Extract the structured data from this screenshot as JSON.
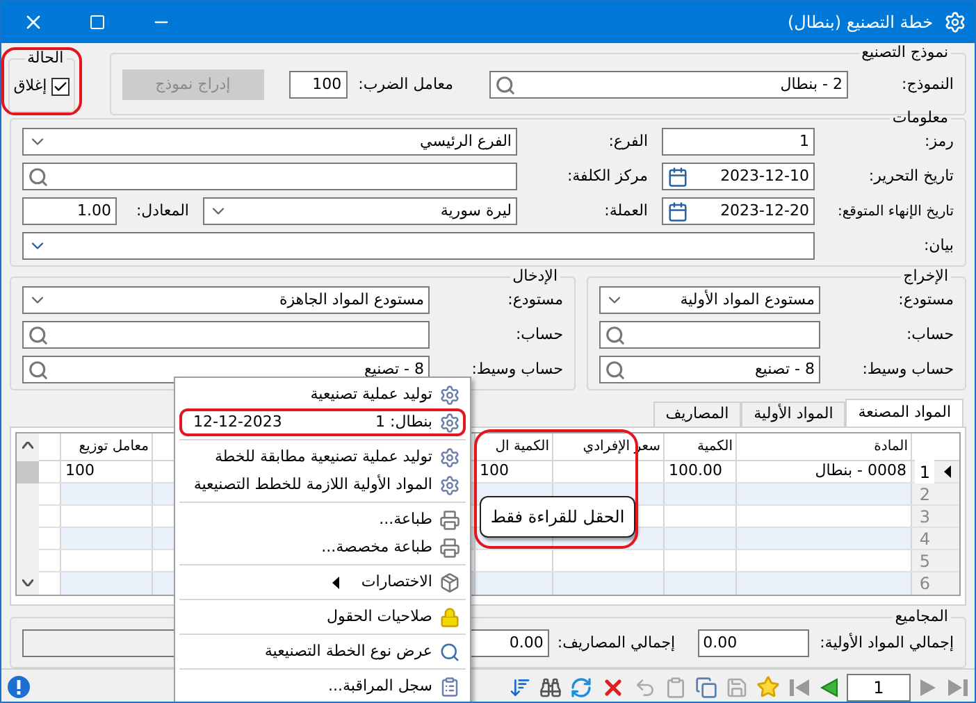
{
  "window": {
    "title": "خطة التصنيع (بنطال)"
  },
  "model_group": {
    "title": "نموذج التصنيع",
    "model_label": "النموذج:",
    "model_value": "2 - بنطال",
    "multiplier_label": "معامل الضرب:",
    "multiplier_value": "100",
    "insert_button": {
      "label": "إدراج نموذج",
      "disabled": true
    }
  },
  "status_group": {
    "title": "الحالة",
    "highlighted": true,
    "closed": {
      "label": "إغلاق",
      "checked": true
    }
  },
  "info": {
    "title": "معلومات",
    "code_label": "رمز:",
    "code": "1",
    "branch_label": "الفرع:",
    "branch": "الفرع الرئيسي",
    "date_label": "تاريخ التحرير:",
    "date": "2023-12-10",
    "cost_center_label": "مركز الكلفة:",
    "end_date_label": "تاريخ الإنهاء المتوقع:",
    "end_date": "2023-12-20",
    "currency_label": "العملة:",
    "currency": "ليرة سورية",
    "rate_label": "المعادل:",
    "rate": "1.00",
    "statement_label": "بيان:"
  },
  "output": {
    "title": "الإخراج",
    "rows": [
      {
        "kind": "select",
        "label": "مستودع:",
        "value": "مستودع المواد الأولية"
      },
      {
        "kind": "search",
        "label": "حساب:"
      },
      {
        "kind": "search",
        "label": "حساب وسيط:",
        "value": "8 - تصنيع"
      }
    ]
  },
  "input": {
    "title": "الإدخال",
    "rows": [
      {
        "kind": "select",
        "label": "مستودع:",
        "value": "مستودع المواد الجاهزة"
      },
      {
        "kind": "search",
        "label": "حساب:"
      },
      {
        "kind": "search",
        "label": "حساب وسيط:",
        "value": "8 - تصنيع"
      }
    ]
  },
  "tabs": [
    {
      "label": "المواد المصنعة",
      "selected": true
    },
    {
      "label": "المواد الأولية",
      "selected": false
    },
    {
      "label": "المصاريف",
      "selected": false
    }
  ],
  "grid": {
    "columns": [
      "المادة",
      "الكمية",
      "سعر الإفرادي",
      "الكمية ال",
      "معامل توزيع"
    ],
    "rows": [
      {
        "number": "1",
        "selected": true,
        "cells": [
          "0008 - بنطال",
          "100.00",
          null,
          "100",
          "100"
        ]
      },
      {
        "number": "2",
        "selected": false
      },
      {
        "number": "3",
        "selected": false
      },
      {
        "number": "4",
        "selected": false
      },
      {
        "number": "5",
        "selected": false
      },
      {
        "number": "6",
        "selected": false
      }
    ]
  },
  "totals": {
    "title": "المجاميع",
    "raw_label": "إجمالي المواد الأولية:",
    "raw": "0.00",
    "expenses_label": "إجمالي المصاريف:",
    "expenses": "0.00"
  },
  "context_menu": {
    "groups": [
      [
        {
          "kind": "gear",
          "label": "توليد عملية تصنيعية",
          "highlighted": false
        },
        {
          "kind": "gear",
          "label": "بنطال: 1",
          "detail": "12-12-2023",
          "highlighted": true
        }
      ],
      [
        {
          "kind": "gear",
          "label": "توليد عملية تصنيعية مطابقة للخطة",
          "highlighted": false
        },
        {
          "kind": "gear",
          "label": "المواد الأولية اللازمة للخطط التصنيعية",
          "highlighted": false
        }
      ],
      [
        {
          "kind": "printer",
          "label": "طباعة...",
          "highlighted": false
        },
        {
          "kind": "printer",
          "label": "طباعة مخصصة...",
          "highlighted": false
        }
      ],
      [
        {
          "kind": "submenu",
          "label": "الاختصارات",
          "highlighted": false
        }
      ],
      [
        {
          "kind": "lock",
          "label": "صلاحيات الحقول",
          "highlighted": false
        }
      ],
      [
        {
          "kind": "search",
          "label": "عرض نوع الخطة التصنيعية",
          "highlighted": false
        }
      ],
      [
        {
          "kind": "log",
          "label": "سجل المراقبة...",
          "highlighted": false
        }
      ]
    ]
  },
  "tooltip": {
    "text": "الحقل للقراءة فقط",
    "highlighted": true
  },
  "toolbar": {
    "page": "1"
  }
}
